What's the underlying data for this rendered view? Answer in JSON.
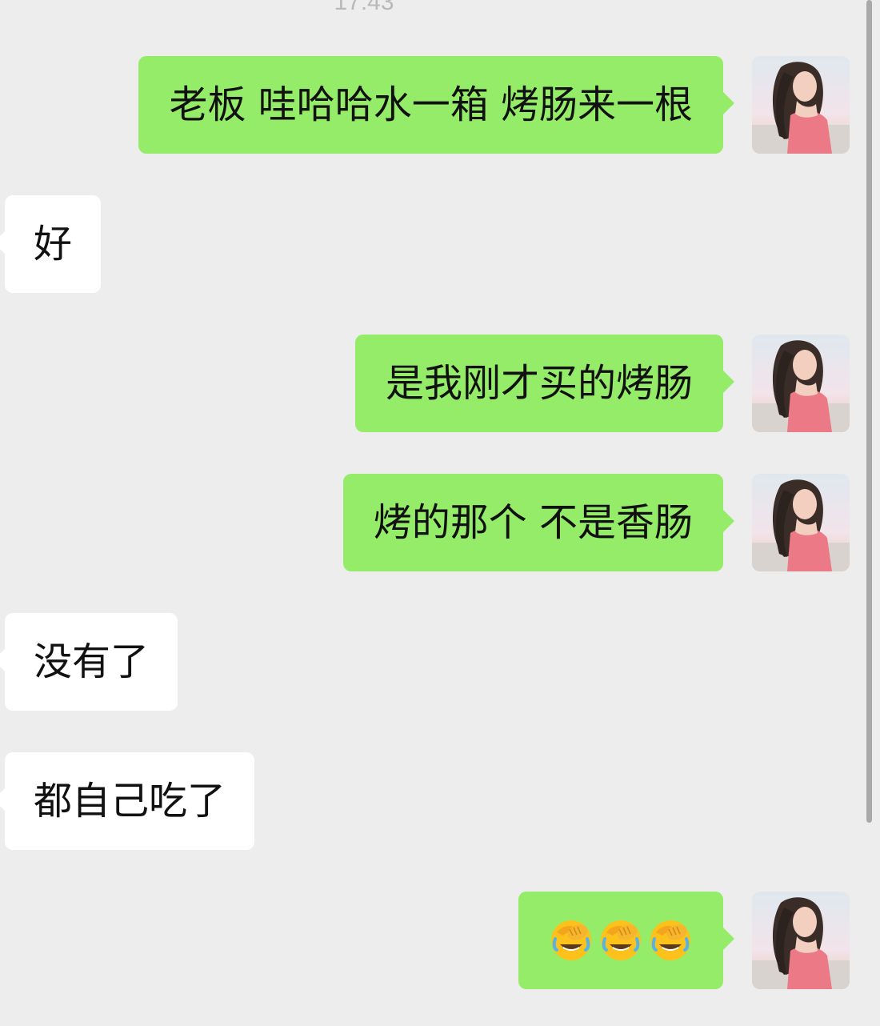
{
  "chat": {
    "timestamp": "17:43",
    "messages": [
      {
        "from": "me",
        "text": "老板 哇哈哈水一箱 烤肠来一根"
      },
      {
        "from": "other",
        "text": "好"
      },
      {
        "from": "me",
        "text": "是我刚才买的烤肠"
      },
      {
        "from": "me",
        "text": "烤的那个 不是香肠"
      },
      {
        "from": "other",
        "text": "没有了"
      },
      {
        "from": "other",
        "text": "都自己吃了"
      },
      {
        "from": "me",
        "emoji": [
          "face-palm-laugh",
          "face-palm-laugh",
          "face-palm-laugh"
        ]
      }
    ]
  },
  "avatar": {
    "icon": "user-avatar-photo"
  },
  "colors": {
    "background": "#ededed",
    "sent_bubble": "#95ec69",
    "received_bubble": "#ffffff",
    "text": "#111111"
  }
}
